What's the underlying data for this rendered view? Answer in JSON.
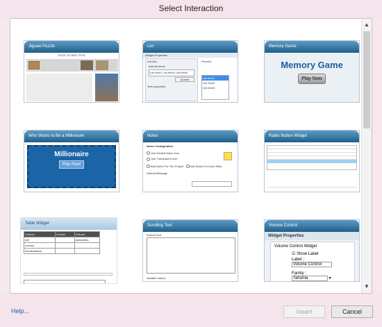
{
  "window": {
    "title": "Select Interaction"
  },
  "cards": [
    {
      "label": "Jigsaw Puzzle",
      "sub": "CLICK TO ADD TITLE"
    },
    {
      "label": "List",
      "props": "Widget Properties",
      "section": "List Box",
      "addlabel": "Add list items",
      "items_text": "List Item1 List Item2 List Item3",
      "update": "Update",
      "preview": "Preview",
      "text_props": "Text properties",
      "list_items": [
        "List Item1",
        "List Item2",
        "List Item3"
      ]
    },
    {
      "label": "Memory Game",
      "heading": "Memory Game",
      "play": "Play Now"
    },
    {
      "label": "Who Wants to Be a Millionaire",
      "heading": "Millionaire",
      "play": "Play Now!"
    },
    {
      "label": "Notes",
      "config": "Notes Configuration",
      "options": [
        "Use Default Notes Icon",
        "Use Transparent Icon",
        "Add Notes For The Project",
        "Add Notes For Each Slide"
      ],
      "message": "Default Message"
    },
    {
      "label": "Radio Button Widget"
    },
    {
      "label": "Table Widget",
      "columns": [
        "Column",
        "Column",
        "Column"
      ],
      "rows": [
        [
          "cell",
          "",
          "abbdedfda"
        ],
        [
          "cndnsd",
          "",
          ""
        ],
        [
          "dsedsdsabda",
          "",
          ""
        ]
      ]
    },
    {
      "label": "Scrolling Text",
      "field1": "Default Text",
      "field2": "Variable Values"
    },
    {
      "label": "Volume Control",
      "props": "Widget Properties",
      "widget": "Volume Control Widget",
      "show": "Show Label",
      "label_text": "Label :",
      "label_value": "Volume Control",
      "family_text": "Family :",
      "family_value": "Tahoma"
    }
  ],
  "footer": {
    "help": "Help...",
    "insert": "Insert",
    "cancel": "Cancel"
  }
}
